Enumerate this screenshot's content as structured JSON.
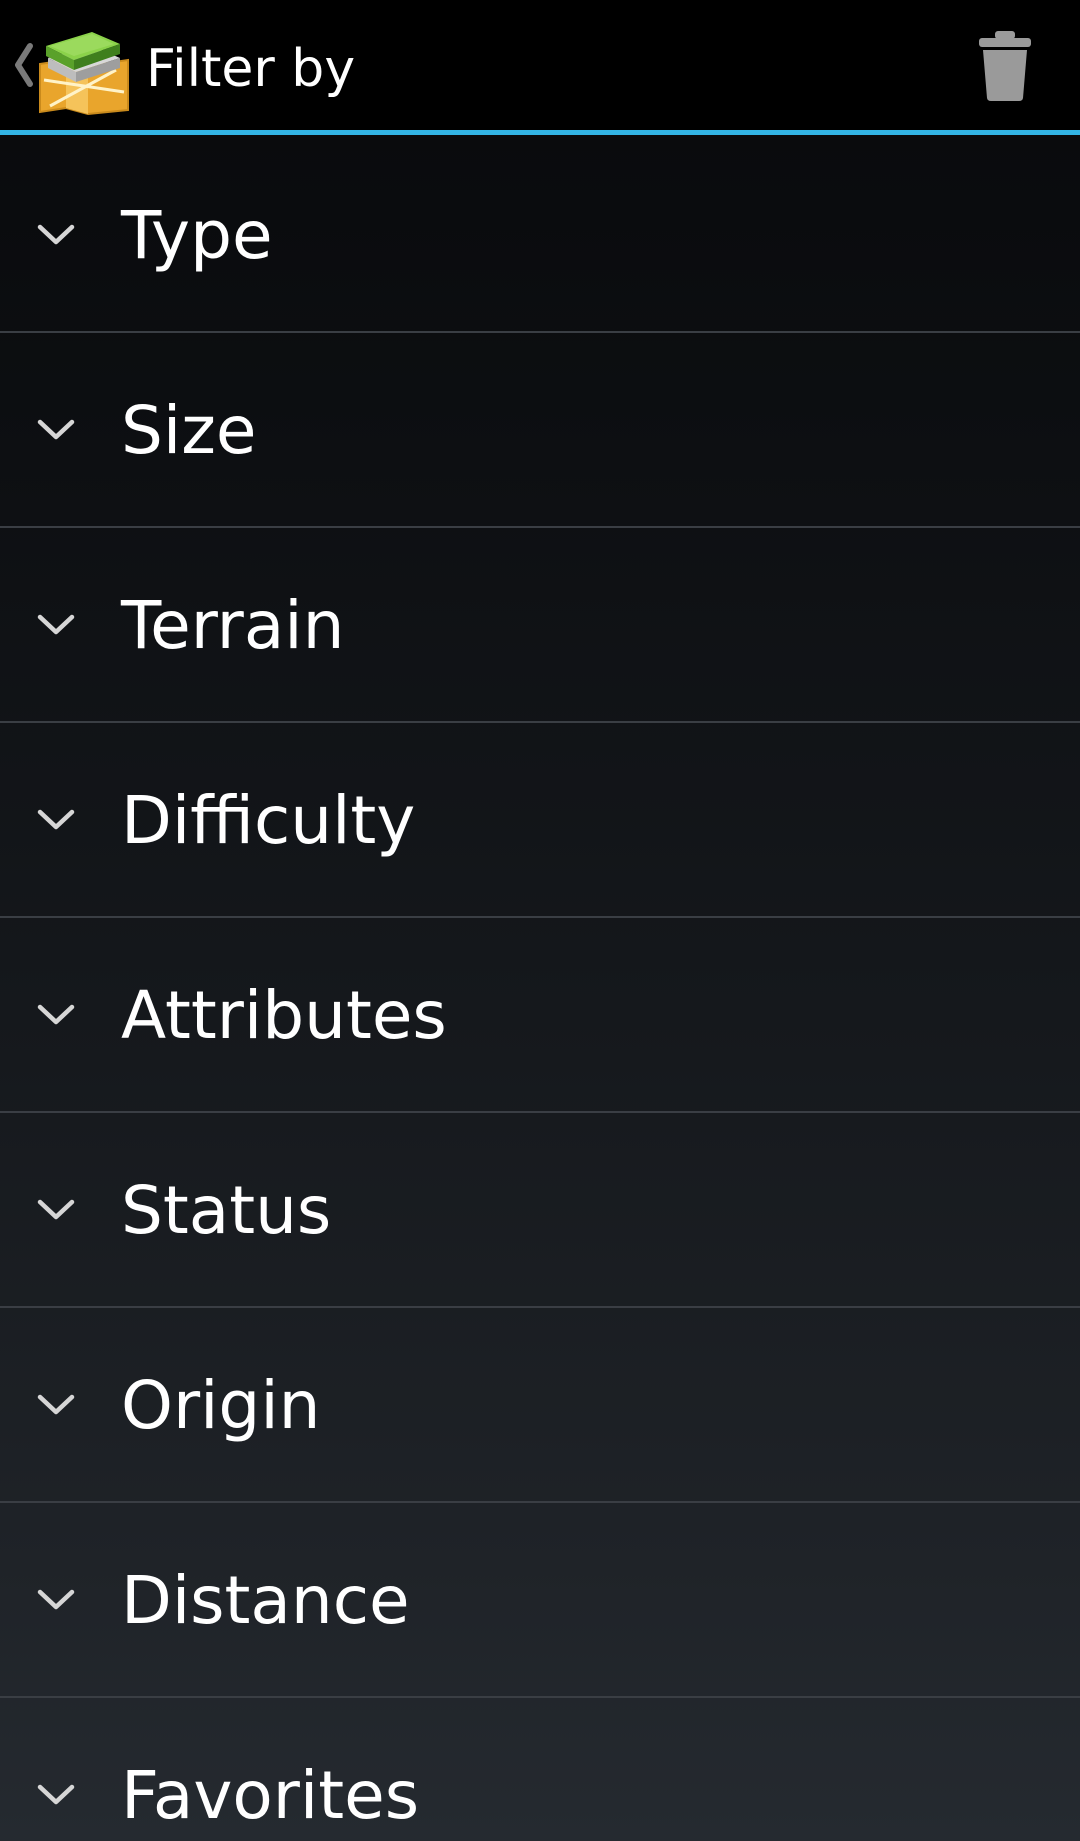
{
  "action_bar": {
    "title": "Filter by",
    "up_icon": "back-caret-icon",
    "app_icon": "geocache-map-app-icon",
    "action_icon": "trash-icon",
    "accent_color": "#33b5e5"
  },
  "filters": [
    {
      "label": "Type",
      "icon": "chevron-down-icon"
    },
    {
      "label": "Size",
      "icon": "chevron-down-icon"
    },
    {
      "label": "Terrain",
      "icon": "chevron-down-icon"
    },
    {
      "label": "Difficulty",
      "icon": "chevron-down-icon"
    },
    {
      "label": "Attributes",
      "icon": "chevron-down-icon"
    },
    {
      "label": "Status",
      "icon": "chevron-down-icon"
    },
    {
      "label": "Origin",
      "icon": "chevron-down-icon"
    },
    {
      "label": "Distance",
      "icon": "chevron-down-icon"
    },
    {
      "label": "Favorites",
      "icon": "chevron-down-icon"
    }
  ]
}
